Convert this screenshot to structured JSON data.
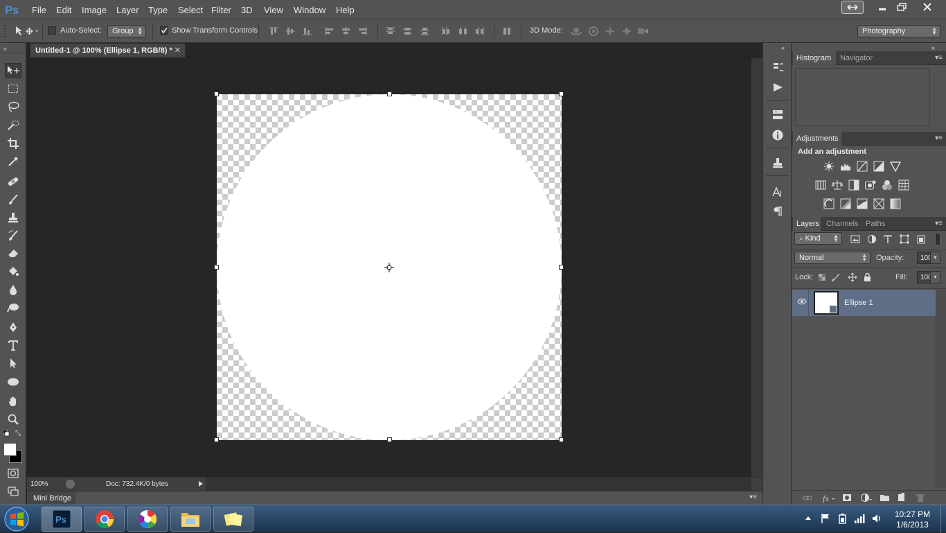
{
  "app": {
    "logo": "Ps"
  },
  "menu": [
    "File",
    "Edit",
    "Image",
    "Layer",
    "Type",
    "Select",
    "Filter",
    "3D",
    "View",
    "Window",
    "Help"
  ],
  "options_bar": {
    "auto_select_label": "Auto-Select:",
    "auto_select_checked": false,
    "auto_select_value": "Group",
    "show_transform_label": "Show Transform Controls",
    "show_transform_checked": true,
    "mode_3d_label": "3D Mode:",
    "workspace": "Photography"
  },
  "document": {
    "tab_title": "Untitled-1 @ 100% (Ellipse 1, RGB/8) *",
    "zoom": "100%",
    "doc_info": "Doc: 732.4K/0 bytes"
  },
  "mini_bridge": {
    "label": "Mini Bridge"
  },
  "panels": {
    "top_tabs": {
      "histogram": "Histogram",
      "navigator": "Navigator"
    },
    "adjustments": {
      "tab": "Adjustments",
      "heading": "Add an adjustment"
    },
    "layers": {
      "tabs": {
        "layers": "Layers",
        "channels": "Channels",
        "paths": "Paths"
      },
      "filter_kind": "Kind",
      "blend_mode": "Normal",
      "opacity_label": "Opacity:",
      "opacity_value": "100%",
      "lock_label": "Lock:",
      "fill_label": "Fill:",
      "fill_value": "100%",
      "items": [
        {
          "name": "Ellipse 1",
          "visible": true,
          "selected": true
        }
      ]
    }
  },
  "taskbar": {
    "apps": [
      "photoshop-icon",
      "chrome-icon",
      "picasa-icon",
      "explorer-icon",
      "sticky-notes-icon"
    ],
    "time": "10:27 PM",
    "date": "1/6/2013"
  }
}
